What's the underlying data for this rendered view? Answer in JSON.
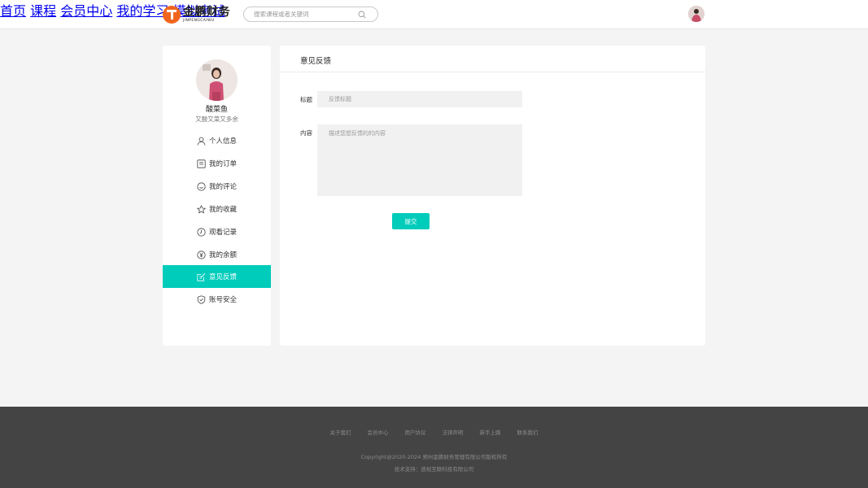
{
  "header": {
    "logo_cn": "金鹏财务",
    "logo_en": "JINPENGCAIWU",
    "search_placeholder": "搜索课程或者关键词",
    "nav": [
      "首页",
      "课程",
      "会员中心",
      "我的学习",
      "模拟考试"
    ]
  },
  "profile": {
    "name": "酸菜鱼",
    "signature": "又酸又菜又多余"
  },
  "sidebar": {
    "items": [
      {
        "label": "个人信息",
        "icon": "user-icon"
      },
      {
        "label": "我的订单",
        "icon": "order-icon"
      },
      {
        "label": "我的评论",
        "icon": "comment-icon"
      },
      {
        "label": "我的收藏",
        "icon": "star-icon"
      },
      {
        "label": "观看记录",
        "icon": "clock-icon"
      },
      {
        "label": "我的余额",
        "icon": "yen-icon"
      },
      {
        "label": "意见反馈",
        "icon": "edit-icon",
        "active": true
      },
      {
        "label": "账号安全",
        "icon": "shield-icon"
      }
    ]
  },
  "feedback": {
    "title": "意见反馈",
    "title_label": "标题",
    "title_placeholder": "反馈标题",
    "content_label": "内容",
    "content_placeholder": "描述您想反馈的的内容",
    "submit_label": "提交"
  },
  "footer": {
    "links": [
      "关于我们",
      "会员中心",
      "用户协议",
      "法律声明",
      "新手上路",
      "联系我们"
    ],
    "copyright": "Copyright@2020-2024 郑州金鹏财务管理有限公司版权所有",
    "tech": "技术支持：透视互联科技有限公司"
  },
  "colors": {
    "accent": "#00ccbb",
    "logo": "#f0661e",
    "footer_bg": "#444444"
  }
}
